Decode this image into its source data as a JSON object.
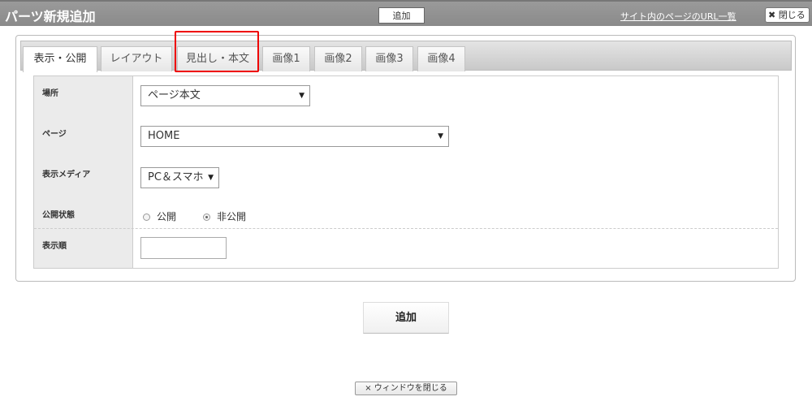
{
  "header": {
    "title": "パーツ新規追加",
    "add_label": "追加",
    "url_list_label": "サイト内のページのURL一覧",
    "close_icon": "✖",
    "close_label": "閉じる"
  },
  "tabs": [
    {
      "label": "表示・公開",
      "active": true
    },
    {
      "label": "レイアウト",
      "active": false
    },
    {
      "label": "見出し・本文",
      "active": false
    },
    {
      "label": "画像1",
      "active": false
    },
    {
      "label": "画像2",
      "active": false
    },
    {
      "label": "画像3",
      "active": false
    },
    {
      "label": "画像4",
      "active": false
    }
  ],
  "form": {
    "location": {
      "label": "場所",
      "value": "ページ本文"
    },
    "page": {
      "label": "ページ",
      "value": "HOME"
    },
    "media": {
      "label": "表示メディア",
      "value": "PC＆スマホ"
    },
    "status": {
      "label": "公開状態",
      "options": [
        "公開",
        "非公開"
      ],
      "selected": "非公開"
    },
    "order": {
      "label": "表示順",
      "value": ""
    },
    "dropdown_arrow": "▼"
  },
  "footer": {
    "submit_label": "追加",
    "close_window_icon": "×",
    "close_window_label": "ウィンドウを閉じる"
  },
  "colors": {
    "highlight": "#e00000",
    "header_bg": "#959595"
  }
}
